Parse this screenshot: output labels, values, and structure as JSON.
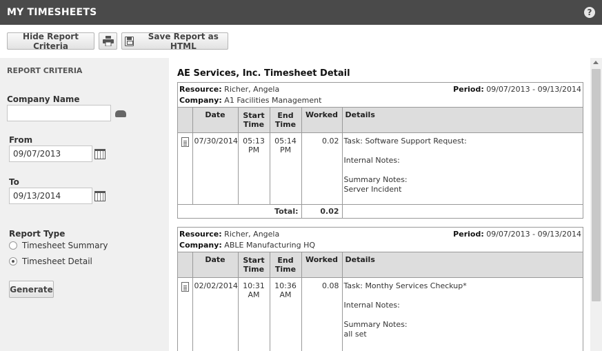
{
  "header": {
    "title": "MY TIMESHEETS",
    "help_label": "?"
  },
  "toolbar": {
    "hide_criteria_label": "Hide Report Criteria",
    "save_html_label": "Save Report as HTML"
  },
  "criteria": {
    "heading": "REPORT CRITERIA",
    "company_label": "Company Name",
    "company_value": "",
    "from_label": "From",
    "from_value": "09/07/2013",
    "to_label": "To",
    "to_value": "09/13/2014",
    "report_type_label": "Report Type",
    "options": [
      {
        "label": "Timesheet Summary",
        "selected": false
      },
      {
        "label": "Timesheet Detail",
        "selected": true
      }
    ],
    "generate_label": "Generate"
  },
  "report": {
    "title": "AE Services, Inc. Timesheet Detail",
    "labels": {
      "resource": "Resource:",
      "company": "Company:",
      "period": "Period:",
      "total": "Total:"
    },
    "columns": {
      "date": "Date",
      "start_1": "Start",
      "start_2": "Time",
      "end_1": "End",
      "end_2": "Time",
      "worked": "Worked",
      "details": "Details"
    },
    "cards": [
      {
        "resource": "Richer, Angela",
        "company": "A1 Facilities Management",
        "period": "09/07/2013 - 09/13/2014",
        "row": {
          "date": "07/30/2014",
          "start_1": "05:13",
          "start_2": "PM",
          "end_1": "05:14",
          "end_2": "PM",
          "worked": "0.02",
          "task": "Task: Software Support Request:",
          "internal": "Internal Notes:",
          "summary_label": "Summary Notes:",
          "summary_text": "Server Incident"
        },
        "total": "0.02"
      },
      {
        "resource": "Richer, Angela",
        "company": "ABLE Manufacturing HQ",
        "period": "09/07/2013 - 09/13/2014",
        "row": {
          "date": "02/02/2014",
          "start_1": "10:31",
          "start_2": "AM",
          "end_1": "10:36",
          "end_2": "AM",
          "worked": "0.08",
          "task": "Task: Monthy Services Checkup*",
          "internal": "Internal Notes:",
          "summary_label": "Summary Notes:",
          "summary_text": "all set"
        }
      }
    ]
  }
}
